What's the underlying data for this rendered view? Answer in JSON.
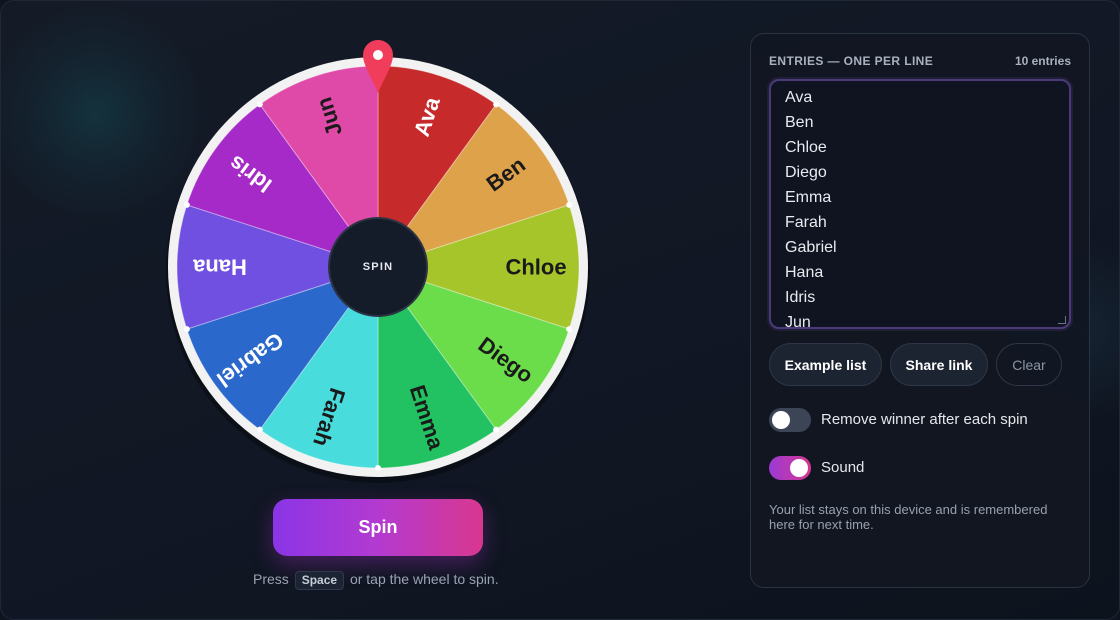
{
  "wheel": {
    "center_label": "SPIN",
    "segments": [
      {
        "label": "Ava",
        "color": "#c62a2a",
        "text_color": "#ffffff"
      },
      {
        "label": "Ben",
        "color": "#dea24a",
        "text_color": "#1a1a1a"
      },
      {
        "label": "Chloe",
        "color": "#a6c52b",
        "text_color": "#1a1a1a"
      },
      {
        "label": "Diego",
        "color": "#6bdc4a",
        "text_color": "#1a1a1a"
      },
      {
        "label": "Emma",
        "color": "#22c262",
        "text_color": "#1a1a1a"
      },
      {
        "label": "Farah",
        "color": "#48dcdc",
        "text_color": "#1a1a1a"
      },
      {
        "label": "Gabriel",
        "color": "#2a68cc",
        "text_color": "#ffffff"
      },
      {
        "label": "Hana",
        "color": "#7050e0",
        "text_color": "#ffffff"
      },
      {
        "label": "Idris",
        "color": "#a52ac8",
        "text_color": "#ffffff"
      },
      {
        "label": "Jun",
        "color": "#df4aa8",
        "text_color": "#1a1a1a"
      }
    ],
    "pointer_color": "#f03d5c",
    "rim_color": "#f2f2f2",
    "hub_color": "#141b29"
  },
  "spin_button": {
    "label": "Spin"
  },
  "hint": {
    "prefix": "Press",
    "key": "Space",
    "suffix": "or tap the wheel to spin."
  },
  "panel": {
    "entries_label": "ENTRIES — ONE PER LINE",
    "entries_count": "10 entries",
    "entries": [
      "Ava",
      "Ben",
      "Chloe",
      "Diego",
      "Emma",
      "Farah",
      "Gabriel",
      "Hana",
      "Idris",
      "Jun"
    ],
    "buttons": {
      "example": "Example list",
      "share": "Share link",
      "clear": "Clear"
    },
    "toggles": {
      "remove_winner": {
        "label": "Remove winner after each spin",
        "on": false
      },
      "sound": {
        "label": "Sound",
        "on": true
      }
    },
    "note": "Your list stays on this device and is remembered here for next time."
  }
}
